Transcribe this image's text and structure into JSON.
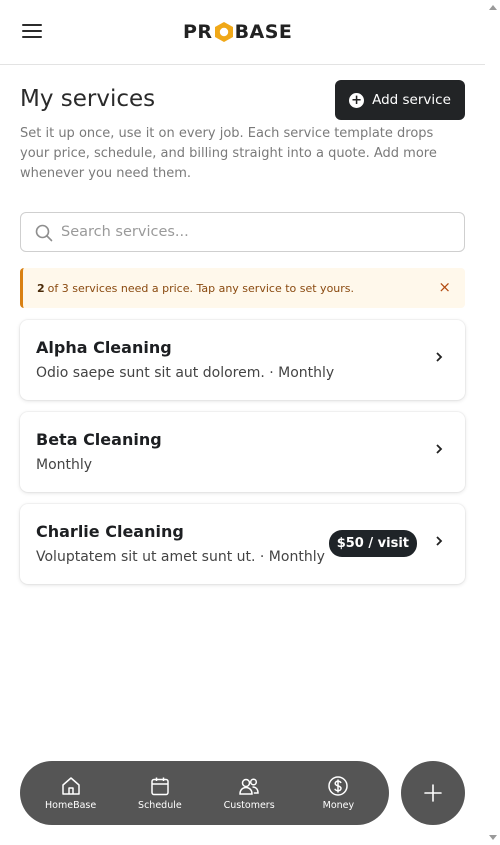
{
  "header": {
    "logo_left": "PR",
    "logo_right": "BASE"
  },
  "page": {
    "title": "My services",
    "add_button_label": "Add service",
    "intro": "Set it up once, use it on every job. Each service template drops your price, schedule, and billing straight into a quote. Add more whenever you need them."
  },
  "search": {
    "placeholder": "Search services...",
    "value": ""
  },
  "alert": {
    "count": "2",
    "message": "of 3 services need a price. Tap any service to set yours.",
    "close_label": "×"
  },
  "services": [
    {
      "name": "Alpha Cleaning",
      "subtitle": "Odio saepe sunt sit aut dolorem. · Monthly",
      "price": ""
    },
    {
      "name": "Beta Cleaning",
      "subtitle": "Monthly",
      "price": ""
    },
    {
      "name": "Charlie Cleaning",
      "subtitle": "Voluptatem sit ut amet sunt ut. · Monthly",
      "price": "$50 / visit"
    }
  ],
  "nav": {
    "items": [
      {
        "label": "HomeBase",
        "icon": "home-icon"
      },
      {
        "label": "Schedule",
        "icon": "calendar-icon"
      },
      {
        "label": "Customers",
        "icon": "users-icon"
      },
      {
        "label": "Money",
        "icon": "dollar-icon"
      }
    ],
    "fab_icon": "plus-icon"
  },
  "colors": {
    "brand_accent": "#f0a818",
    "dark_button": "#222426",
    "alert_border": "#d98012",
    "alert_bg": "#fff8eb",
    "nav_bg": "#555555"
  }
}
